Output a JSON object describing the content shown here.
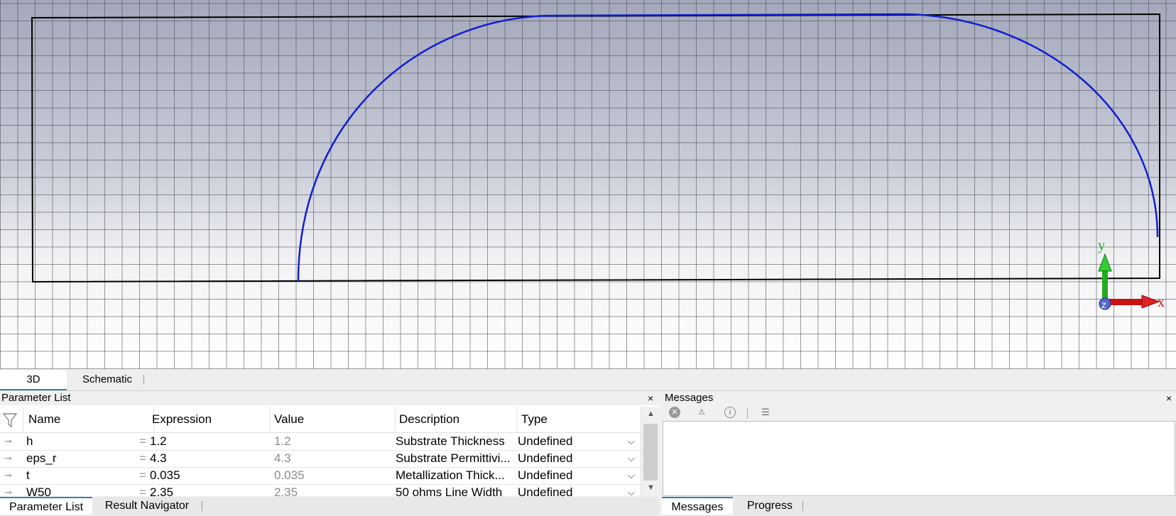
{
  "view_tabs": [
    "3D",
    "Schematic"
  ],
  "axes": {
    "x": "x",
    "y": "y",
    "z": "z"
  },
  "colors": {
    "curve": "#1020d0",
    "outline": "#000000",
    "axis_x": "#cc1111",
    "axis_y": "#22aa22",
    "axis_z": "#4444aa",
    "tab_accent": "#3c7fb1"
  },
  "parameter_list": {
    "title": "Parameter List",
    "close": "×",
    "columns": [
      "Name",
      "Expression",
      "Value",
      "Description",
      "Type"
    ],
    "rows": [
      {
        "name": "h",
        "expression": "1.2",
        "value": "1.2",
        "description": "Substrate Thickness",
        "type": "Undefined"
      },
      {
        "name": "eps_r",
        "expression": "4.3",
        "value": "4.3",
        "description": "Substrate Permittivi...",
        "type": "Undefined"
      },
      {
        "name": "t",
        "expression": "0.035",
        "value": "0.035",
        "description": "Metallization Thick...",
        "type": "Undefined"
      },
      {
        "name": "W50",
        "expression": "2.35",
        "value": "2.35",
        "description": "50 ohms Line Width",
        "type": "Undefined"
      }
    ]
  },
  "messages": {
    "title": "Messages",
    "close": "×",
    "toolbar": [
      "error-filter-icon",
      "warning-filter-icon",
      "info-filter-icon",
      "clear-list-icon"
    ]
  },
  "bottom_tabs_left": [
    "Parameter List",
    "Result Navigator"
  ],
  "bottom_tabs_right": [
    "Messages",
    "Progress"
  ]
}
